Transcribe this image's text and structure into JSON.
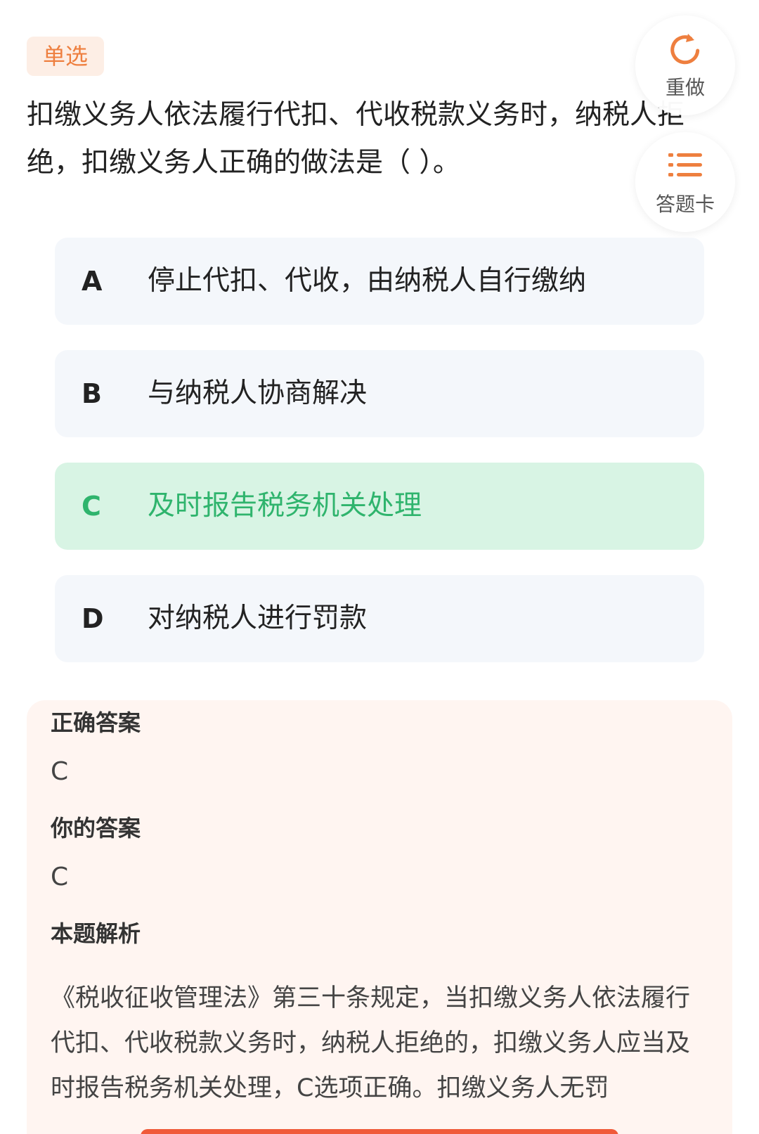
{
  "question": {
    "type_label": "单选",
    "text": "扣缴义务人依法履行代扣、代收税款义务时，纳税人拒绝，扣缴义务人正确的做法是（ ）。"
  },
  "actions": {
    "redo_label": "重做",
    "answer_card_label": "答题卡"
  },
  "options": [
    {
      "letter": "A",
      "text": "停止代扣、代收，由纳税人自行缴纳"
    },
    {
      "letter": "B",
      "text": "与纳税人协商解决"
    },
    {
      "letter": "C",
      "text": "及时报告税务机关处理"
    },
    {
      "letter": "D",
      "text": "对纳税人进行罚款"
    }
  ],
  "analysis": {
    "correct_answer_label": "正确答案",
    "correct_answer": "C",
    "your_answer_label": "你的答案",
    "your_answer": "C",
    "explanation_label": "本题解析",
    "explanation": "《税收征收管理法》第三十条规定，当扣缴义务人依法履行代扣、代收税款义务时，纳税人拒绝的，扣缴义务人应当及时报告税务机关处理，C选项正确。扣缴义务人无罚"
  },
  "colors": {
    "accent_orange": "#ee7f3f",
    "correct_green": "#2fb46d",
    "correct_bg": "#d8f4e4",
    "option_bg": "#f4f7fb",
    "analysis_bg": "#fff5f1"
  },
  "icons": {
    "redo": "redo-icon",
    "answer_card": "list-icon"
  }
}
